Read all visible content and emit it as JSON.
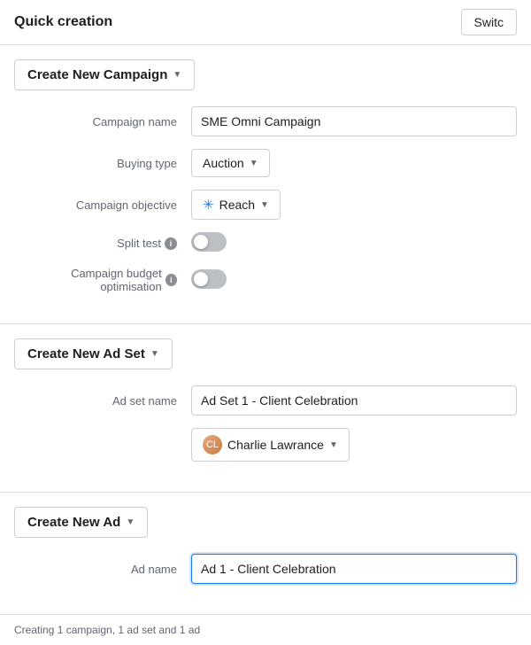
{
  "header": {
    "title": "Quick creation",
    "switch_label": "Switc"
  },
  "campaign_section": {
    "btn_label": "Create New Campaign",
    "fields": [
      {
        "label": "Campaign name",
        "type": "text",
        "value": "SME Omni Campaign",
        "name": "campaign-name-input"
      },
      {
        "label": "Buying type",
        "type": "dropdown",
        "value": "Auction",
        "name": "buying-type-dropdown"
      },
      {
        "label": "Campaign objective",
        "type": "reach-dropdown",
        "value": "Reach",
        "name": "campaign-objective-dropdown"
      },
      {
        "label": "Split test",
        "type": "toggle",
        "has_info": true,
        "name": "split-test-toggle"
      },
      {
        "label": "Campaign budget optimisation",
        "type": "toggle",
        "has_info": true,
        "name": "campaign-budget-toggle"
      }
    ]
  },
  "adset_section": {
    "btn_label": "Create New Ad Set",
    "fields": [
      {
        "label": "Ad set name",
        "type": "text",
        "value": "Ad Set 1 - Client Celebration",
        "name": "adset-name-input"
      },
      {
        "label": "",
        "type": "person-dropdown",
        "value": "Charlie Lawrance",
        "name": "person-dropdown"
      }
    ]
  },
  "ad_section": {
    "btn_label": "Create New Ad",
    "fields": [
      {
        "label": "Ad name",
        "type": "text-active",
        "value": "Ad 1 - Client Celebration",
        "name": "ad-name-input"
      }
    ]
  },
  "footer": {
    "text": "Creating 1 campaign, 1 ad set and 1 ad"
  }
}
